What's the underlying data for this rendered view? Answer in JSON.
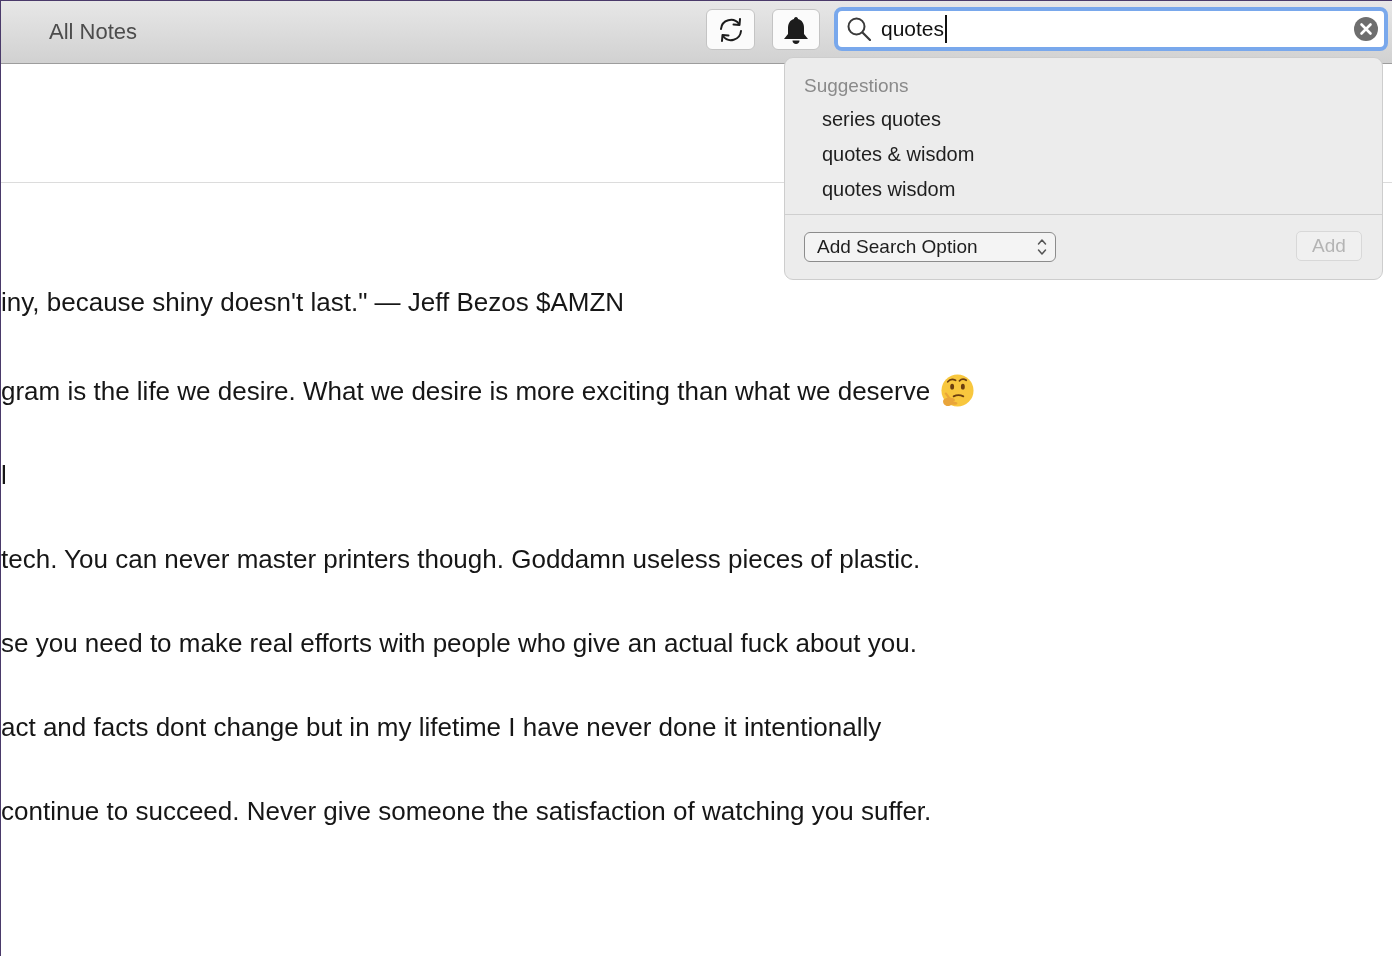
{
  "toolbar": {
    "title": "All Notes",
    "search": {
      "value": "quotes",
      "focused": true
    }
  },
  "suggestions": {
    "heading": "Suggestions",
    "items": [
      {
        "label": "series quotes",
        "selected": false
      },
      {
        "label": "quotes & wisdom",
        "selected": false
      },
      {
        "label": "quotes wisdom",
        "selected": false
      }
    ],
    "search_option": "Add Search Option",
    "add_button": {
      "label": "Add",
      "disabled": true
    }
  },
  "note": {
    "lines": [
      {
        "text": "iny, because shiny doesn't last.\" — Jeff Bezos $AMZN"
      },
      {
        "text": "gram is the life we desire. What we desire is more exciting than what we deserve",
        "emoji": true
      },
      {
        "text": "l"
      },
      {
        "text": "tech. You can never master printers though. Goddamn useless pieces of plastic."
      },
      {
        "text": "se you need to make real efforts with people who give an actual fuck about you."
      },
      {
        "text": "act and facts dont change but in my lifetime I have never done it intentionally"
      },
      {
        "text": "continue to succeed. Never give someone the satisfaction of watching you suffer."
      }
    ]
  }
}
